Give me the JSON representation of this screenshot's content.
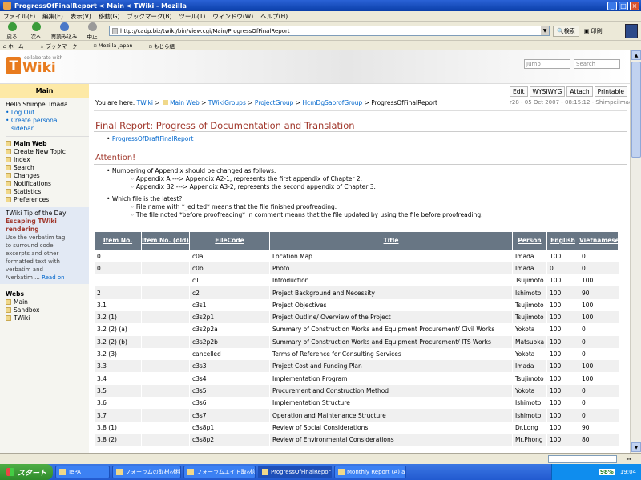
{
  "window": {
    "title": "ProgressOfFinalReport < Main < TWiki - Mozilla",
    "btn_min": "_",
    "btn_max": "□",
    "btn_close": "×"
  },
  "menu": [
    "ファイル(F)",
    "編集(E)",
    "表示(V)",
    "移動(G)",
    "ブックマーク(B)",
    "ツール(T)",
    "ウィンドウ(W)",
    "ヘルプ(H)"
  ],
  "toolbar": {
    "back": "戻る",
    "forward": "次へ",
    "reload": "再読み込み",
    "stop": "中止",
    "url": "http://cadp.biz/twiki/bin/view.cgi/Main/ProgressOfFinalReport",
    "search": "検索",
    "print": "印刷"
  },
  "bookmarks": [
    "ホーム",
    "ブックマーク",
    "Mozilla Japan",
    "もじら組"
  ],
  "twiki": {
    "collab": "collaborate with",
    "logo_t": "T",
    "logo_wiki": "Wiki",
    "jump_placeholder": "Jump",
    "search_placeholder": "Search"
  },
  "sidebar": {
    "web": "Main",
    "hello": "Hello Shimpei Imada",
    "logout": "Log Out",
    "create_personal": "Create personal",
    "sidebar_word": "sidebar",
    "main_web": "Main Web",
    "items": [
      "Create New Topic",
      "Index",
      "Search",
      "Changes",
      "Notifications",
      "Statistics",
      "Preferences"
    ],
    "tip_title": "TWiki Tip of the Day",
    "tip_head1": "Escaping TWiki",
    "tip_head2": "rendering",
    "tip_lines": [
      "Use the verbatim tag",
      "to surround code",
      "excerpts and other",
      "formatted text with",
      "verbatim and",
      "/verbatim ..."
    ],
    "tip_more": "Read on",
    "webs_title": "Webs",
    "webs": [
      "Main",
      "Sandbox",
      "TWiki"
    ]
  },
  "actions": [
    "Edit",
    "WYSIWYG",
    "Attach",
    "Printable"
  ],
  "breadcrumb": {
    "prefix": "You are here:",
    "items": [
      "TWiki",
      "Main Web",
      "TWikiGroups",
      "ProjectGroup",
      "HcmDgSaprofGroup"
    ],
    "current": "ProgressOfFinalReport"
  },
  "revision": "r28 - 05 Oct 2007 - 08:15:12 - ShimpeiImada",
  "content": {
    "heading": "Final Report: Progress of Documentation and Translation",
    "sublink": "ProgressOfDraftFinalReport",
    "attention": "Attention!",
    "bullet1": "Numbering of Appendix should be changed as follows:",
    "bullet1_sub": [
      "Appendix A ---> Appendix A2-1, represents the first appendix of Chapter 2.",
      "Appendix B2 ---> Appendix A3-2, represents the second appendix of Chapter 3."
    ],
    "bullet2": "Which file is the latest?",
    "bullet2_sub": [
      "File name with *_edited* means that the file finished proofreading.",
      "The file noted *before proofreading* in comment means that the file updated by using the file before proofreading."
    ]
  },
  "table": {
    "headers": [
      "Item No.",
      "Item No. (old)",
      "FileCode",
      "Title",
      "Person",
      "English",
      "Vietnamese"
    ],
    "rows": [
      [
        "0",
        "",
        "c0a",
        "Location Map",
        "Imada",
        "100",
        "0"
      ],
      [
        "0",
        "",
        "c0b",
        "Photo",
        "Imada",
        "0",
        "0"
      ],
      [
        "1",
        "",
        "c1",
        "Introduction",
        "Tsujimoto",
        "100",
        "100"
      ],
      [
        "2",
        "",
        "c2",
        "Project Background and Necessity",
        "Ishimoto",
        "100",
        "90"
      ],
      [
        "3.1",
        "",
        "c3s1",
        "Project Objectives",
        "Tsujimoto",
        "100",
        "100"
      ],
      [
        "3.2 (1)",
        "",
        "c3s2p1",
        "Project Outline/ Overview of the Project",
        "Tsujimoto",
        "100",
        "100"
      ],
      [
        "3.2 (2) (a)",
        "",
        "c3s2p2a",
        "Summary of Construction Works and Equipment Procurement/ Civil Works",
        "Yokota",
        "100",
        "0"
      ],
      [
        "3.2 (2) (b)",
        "",
        "c3s2p2b",
        "Summary of Construction Works and Equipment Procurement/ ITS Works",
        "Matsuoka",
        "100",
        "0"
      ],
      [
        "3.2 (3)",
        "",
        "cancelled",
        "Terms of Reference for Consulting Services",
        "Yokota",
        "100",
        "0"
      ],
      [
        "3.3",
        "",
        "c3s3",
        "Project Cost and Funding Plan",
        "Imada",
        "100",
        "100"
      ],
      [
        "3.4",
        "",
        "c3s4",
        "Implementation Program",
        "Tsujimoto",
        "100",
        "100"
      ],
      [
        "3.5",
        "",
        "c3s5",
        "Procurement and Construction Method",
        "Yokota",
        "100",
        "0"
      ],
      [
        "3.6",
        "",
        "c3s6",
        "Implementation Structure",
        "Ishimoto",
        "100",
        "0"
      ],
      [
        "3.7",
        "",
        "c3s7",
        "Operation and Maintenance Structure",
        "Ishimoto",
        "100",
        "0"
      ],
      [
        "3.8 (1)",
        "",
        "c3s8p1",
        "Review of Social Considerations",
        "Dr.Long",
        "100",
        "90"
      ],
      [
        "3.8 (2)",
        "",
        "c3s8p2",
        "Review of Environmental Considerations",
        "Mr.Phong",
        "100",
        "80"
      ]
    ]
  },
  "taskbar": {
    "start": "スタート",
    "tasks": [
      "TePA",
      "フォーラムの取材材料",
      "フォーラムエイト取材記...",
      "ProgressOfFinalReport...",
      "Monthly Report (A) a..."
    ],
    "battery": "98%",
    "clock": "19:04"
  }
}
